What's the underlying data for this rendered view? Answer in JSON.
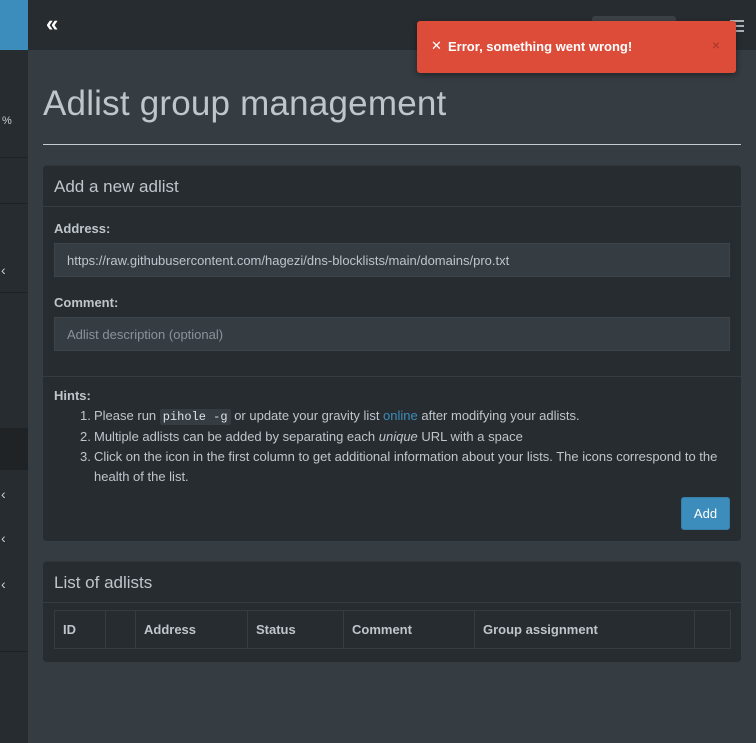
{
  "sidebar": {
    "stat_fragment": "%",
    "chevron": "‹"
  },
  "topbar": {
    "collapse_glyph": "«"
  },
  "toast": {
    "icon": "✕",
    "message": "Error, something went wrong!",
    "close": "×"
  },
  "page": {
    "title": "Adlist group management"
  },
  "add_box": {
    "title": "Add a new adlist",
    "address_label": "Address:",
    "address_value": "https://raw.githubusercontent.com/hagezi/dns-blocklists/main/domains/pro.txt",
    "comment_label": "Comment:",
    "comment_placeholder": "Adlist description (optional)",
    "hints_title": "Hints:",
    "hint1_pre": "Please run ",
    "hint1_code": "pihole -g",
    "hint1_mid": " or update your gravity list ",
    "hint1_link": "online",
    "hint1_post": " after modifying your adlists.",
    "hint2_pre": "Multiple adlists can be added by separating each ",
    "hint2_em": "unique",
    "hint2_post": " URL with a space",
    "hint3": "Click on the icon in the first column to get additional information about your lists. The icons correspond to the health of the list.",
    "add_button": "Add"
  },
  "list_box": {
    "title": "List of adlists",
    "columns": [
      "ID",
      "",
      "Address",
      "Status",
      "Comment",
      "Group assignment",
      ""
    ]
  },
  "colors": {
    "accent": "#3c8dbc",
    "error": "#dd4b39",
    "panel": "#272c30",
    "background": "#353c42"
  }
}
